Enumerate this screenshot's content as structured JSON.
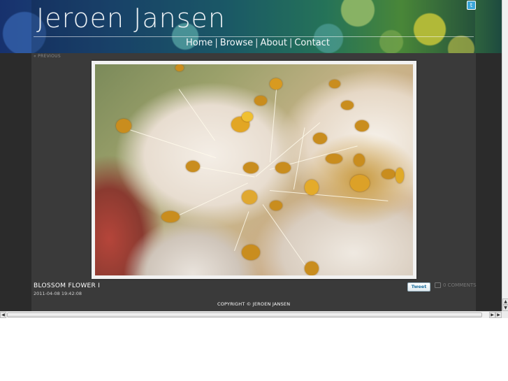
{
  "header": {
    "site_title": "Jeroen Jansen",
    "nav": [
      {
        "label": "Home"
      },
      {
        "label": "Browse"
      },
      {
        "label": "About"
      },
      {
        "label": "Contact"
      }
    ],
    "nav_separator": "|"
  },
  "photo_nav": {
    "previous_label": "« PREVIOUS"
  },
  "photo": {
    "title": "BLOSSOM FLOWER I",
    "date": "2011-04-08 19:42:08"
  },
  "social": {
    "tweet_label": "Tweet",
    "comments_label": "0 COMMENTS"
  },
  "footer": {
    "copyright": "COPYRIGHT © JEROEN JANSEN"
  },
  "scrollbars": {
    "up_arrow": "▲",
    "down_arrow": "▼",
    "left_arrow": "◀",
    "right_arrow": "▶"
  },
  "colors": {
    "page_background": "#2b2b2b",
    "content_background": "#3a3a3a",
    "frame": "#f2f2f2"
  }
}
